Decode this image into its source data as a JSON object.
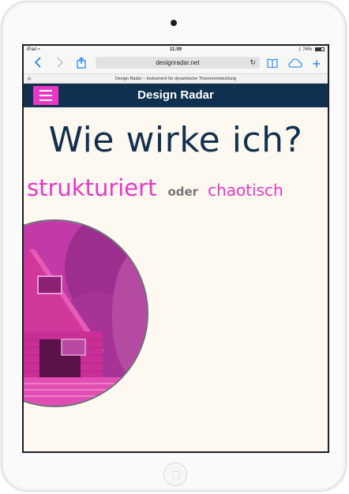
{
  "status": {
    "carrier": "iPad",
    "time": "11:09",
    "battery": "74%"
  },
  "browser": {
    "url": "designradar.net",
    "tab_title": "Design Radar – Instrument für dynamische Theorieentwicklung"
  },
  "site": {
    "title": "Design Radar"
  },
  "main": {
    "headline": "Wie wirke ich?",
    "option_a": "strukturiert",
    "connector": "oder",
    "option_b": "chaotisch"
  },
  "colors": {
    "accent": "#e937c6",
    "navy": "#10304f",
    "page_bg": "#fdf8f0",
    "ios_blue": "#1a7ef7"
  },
  "icons": [
    "wifi-icon",
    "bluetooth-icon",
    "battery-icon",
    "back-icon",
    "forward-icon",
    "share-icon",
    "reload-icon",
    "bookmarks-icon",
    "icloud-tabs-icon",
    "new-tab-icon",
    "menu-icon"
  ]
}
